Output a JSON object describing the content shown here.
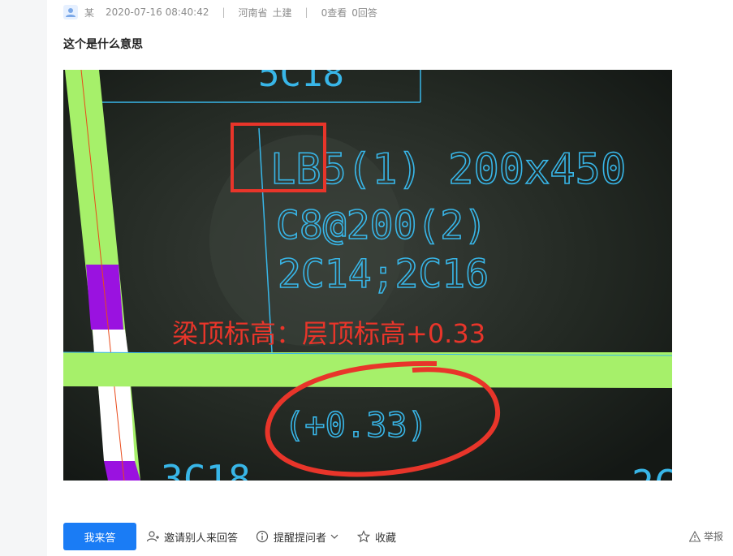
{
  "question": {
    "author": "某",
    "date": "2020-07-16 08:40:42",
    "province": "河南省",
    "category": "土建",
    "views": "0查看",
    "answers": "0回答",
    "title": "这个是什么意思"
  },
  "image": {
    "drawing_lines": [
      "LB5(1) 200x450",
      "C8@200(2)",
      "2C14;2C16"
    ],
    "elevation": "(+0.33)",
    "annotation": "梁顶标高：层顶标高+0.33",
    "bottom_left_text": "3C18",
    "top_partial_text": "5C18",
    "right_partial_text": "2C",
    "colors": {
      "annotation": "#e8352a",
      "cad_text": "#38b6e8",
      "beam": "#a6f06a"
    }
  },
  "actions": {
    "answer_label": "我来答",
    "invite_label": "邀请别人来回答",
    "remind_label": "提醒提问者",
    "favorite_label": "收藏",
    "report_label": "举报"
  }
}
